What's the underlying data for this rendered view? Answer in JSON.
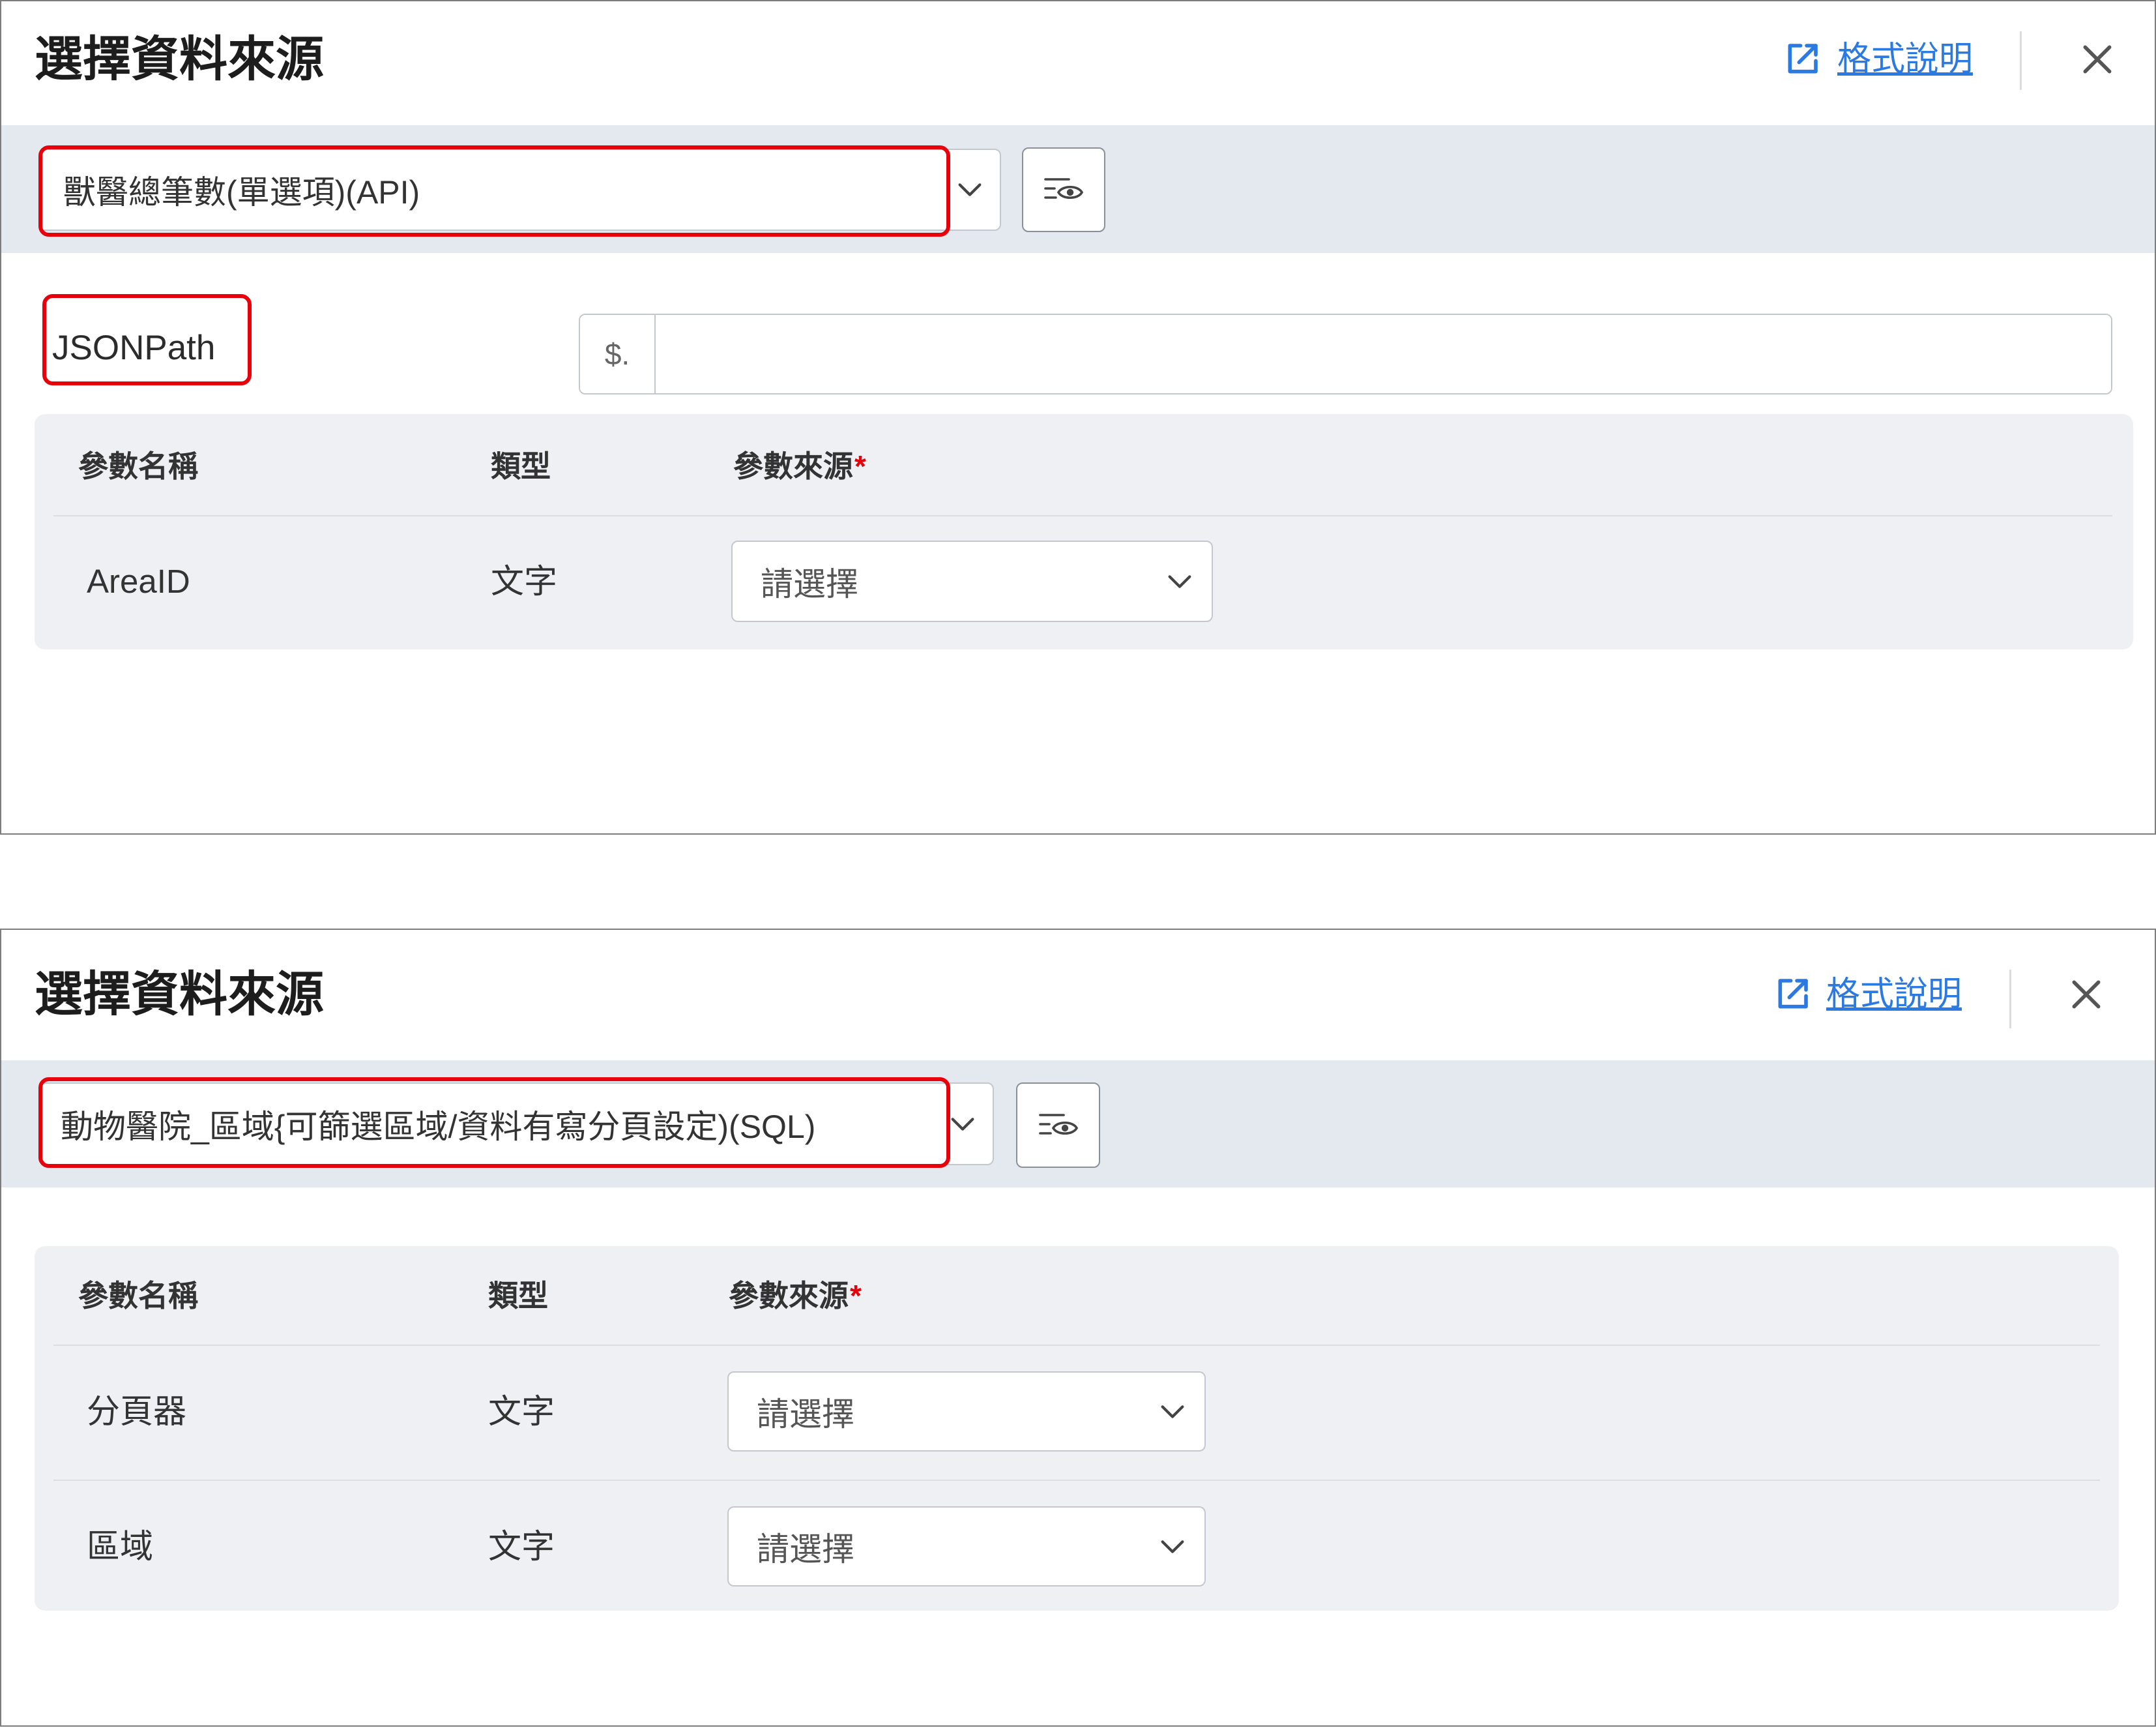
{
  "colors": {
    "link": "#2a7ae2",
    "annotation": "#e8000b",
    "required": "#e8000b",
    "toolbar_band": "#e4e8ef",
    "params_bg": "#eff0f4"
  },
  "icons": {
    "help": "external-link-icon",
    "close": "close-icon",
    "dropdown": "chevron-down-icon",
    "preview": "eye-filter-icon"
  },
  "dialogs": [
    {
      "title": "選擇資料來源",
      "help_link": "格式說明",
      "data_source": {
        "selected": "獸醫總筆數(單選項)(API)"
      },
      "jsonpath": {
        "label": "JSONPath",
        "prefix": "$.",
        "value": ""
      },
      "params": {
        "headers": {
          "name": "參數名稱",
          "type": "類型",
          "source": "參數來源",
          "required_mark": "*"
        },
        "rows": [
          {
            "name": "AreaID",
            "type": "文字",
            "source": "請選擇"
          }
        ]
      }
    },
    {
      "title": "選擇資料來源",
      "help_link": "格式說明",
      "data_source": {
        "selected": "動物醫院_區域{可篩選區域/資料有寫分頁設定)(SQL)"
      },
      "params": {
        "headers": {
          "name": "參數名稱",
          "type": "類型",
          "source": "參數來源",
          "required_mark": "*"
        },
        "rows": [
          {
            "name": "分頁器",
            "type": "文字",
            "source": "請選擇"
          },
          {
            "name": "區域",
            "type": "文字",
            "source": "請選擇"
          }
        ]
      }
    }
  ]
}
